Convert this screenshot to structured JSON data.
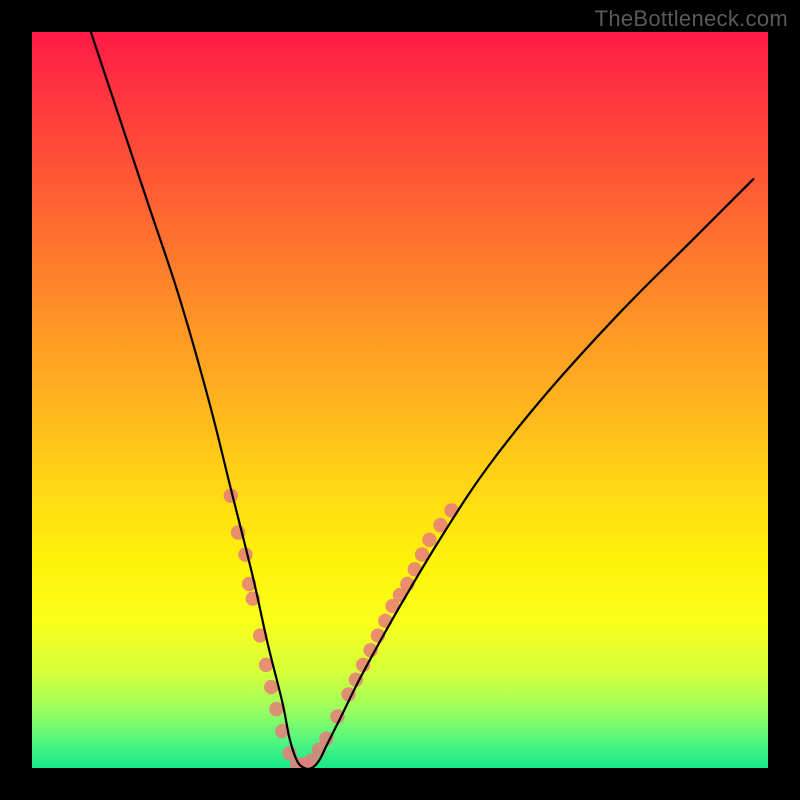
{
  "watermark": "TheBottleneck.com",
  "chart_data": {
    "type": "line",
    "title": "",
    "xlabel": "",
    "ylabel": "",
    "xlim": [
      0,
      100
    ],
    "ylim": [
      0,
      100
    ],
    "gradient_meaning": "vertical color gradient from red (high bottleneck) at top to green (no bottleneck) at bottom",
    "series": [
      {
        "name": "bottleneck-curve",
        "description": "V-shaped black curve; minimum (optimal balance) near x≈36 touching y≈0; left branch steep descending, right branch rising",
        "x": [
          8,
          12,
          16,
          20,
          24,
          27,
          30,
          32,
          34,
          35,
          36,
          37,
          38,
          39,
          40,
          42,
          45,
          50,
          56,
          62,
          70,
          80,
          90,
          98
        ],
        "y": [
          100,
          88,
          76,
          64,
          50,
          38,
          26,
          17,
          9,
          4,
          1,
          0,
          0,
          1,
          3,
          7,
          13,
          22,
          32,
          41,
          51,
          62,
          72,
          80
        ]
      },
      {
        "name": "data-points",
        "description": "pink/salmon sample dots clustered along both branches near the valley",
        "points": [
          {
            "x": 27.0,
            "y": 37
          },
          {
            "x": 28.0,
            "y": 32
          },
          {
            "x": 29.0,
            "y": 29
          },
          {
            "x": 29.5,
            "y": 25
          },
          {
            "x": 30.0,
            "y": 23
          },
          {
            "x": 31.0,
            "y": 18
          },
          {
            "x": 31.8,
            "y": 14
          },
          {
            "x": 32.5,
            "y": 11
          },
          {
            "x": 33.2,
            "y": 8
          },
          {
            "x": 34.0,
            "y": 5
          },
          {
            "x": 35.0,
            "y": 2
          },
          {
            "x": 36.0,
            "y": 0.5
          },
          {
            "x": 37.0,
            "y": 0.5
          },
          {
            "x": 38.0,
            "y": 1
          },
          {
            "x": 39.0,
            "y": 2.5
          },
          {
            "x": 40.0,
            "y": 4
          },
          {
            "x": 41.5,
            "y": 7
          },
          {
            "x": 43.0,
            "y": 10
          },
          {
            "x": 44.0,
            "y": 12
          },
          {
            "x": 45.0,
            "y": 14
          },
          {
            "x": 46.0,
            "y": 16
          },
          {
            "x": 47.0,
            "y": 18
          },
          {
            "x": 48.0,
            "y": 20
          },
          {
            "x": 49.0,
            "y": 22
          },
          {
            "x": 50.0,
            "y": 23.5
          },
          {
            "x": 51.0,
            "y": 25
          },
          {
            "x": 52.0,
            "y": 27
          },
          {
            "x": 53.0,
            "y": 29
          },
          {
            "x": 54.0,
            "y": 31
          },
          {
            "x": 55.5,
            "y": 33
          },
          {
            "x": 57.0,
            "y": 35
          }
        ]
      }
    ]
  }
}
